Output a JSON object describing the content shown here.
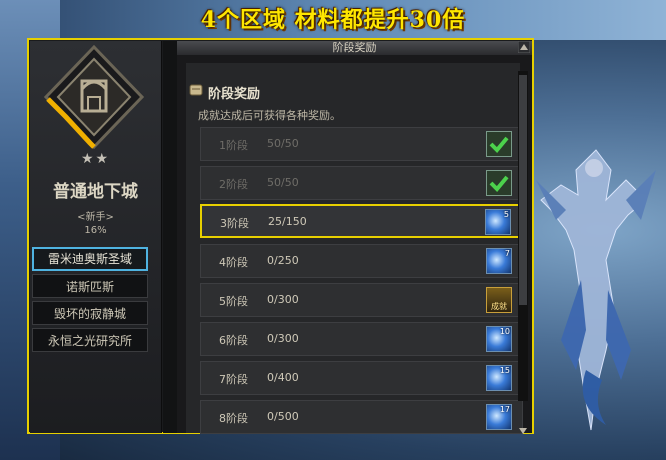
{
  "banner": "4个区域 材料都提升30倍",
  "dungeon": {
    "stars": "★★",
    "name": "普通地下城",
    "level": "<新手>",
    "percent": "16%",
    "list": [
      {
        "label": "雷米迪奥斯圣域",
        "active": true
      },
      {
        "label": "诺斯匹斯",
        "active": false
      },
      {
        "label": "毁坏的寂静城",
        "active": false
      },
      {
        "label": "永恒之光研究所",
        "active": false
      }
    ]
  },
  "reward": {
    "window_title": "阶段奖励",
    "heading": "阶段奖励",
    "description": "成就达成后可获得各种奖励。",
    "rows": [
      {
        "stage": "1阶段",
        "progress": "50/50",
        "icon": "check",
        "count": ""
      },
      {
        "stage": "2阶段",
        "progress": "50/50",
        "icon": "check",
        "count": ""
      },
      {
        "stage": "3阶段",
        "progress": "25/150",
        "icon": "blue",
        "count": "5",
        "selected": true
      },
      {
        "stage": "4阶段",
        "progress": "0/250",
        "icon": "blue",
        "count": "7"
      },
      {
        "stage": "5阶段",
        "progress": "0/300",
        "icon": "gold",
        "count": "",
        "gold_label": "成就"
      },
      {
        "stage": "6阶段",
        "progress": "0/300",
        "icon": "blue",
        "count": "10"
      },
      {
        "stage": "7阶段",
        "progress": "0/400",
        "icon": "blue",
        "count": "15"
      },
      {
        "stage": "8阶段",
        "progress": "0/500",
        "icon": "blue",
        "count": "17"
      }
    ]
  },
  "colors": {
    "banner": "#ffe600",
    "frame_border": "#e6d000",
    "selected_border": "#e8d000",
    "active_list_border": "#4fb3e0",
    "check_green": "#4cd24c"
  }
}
